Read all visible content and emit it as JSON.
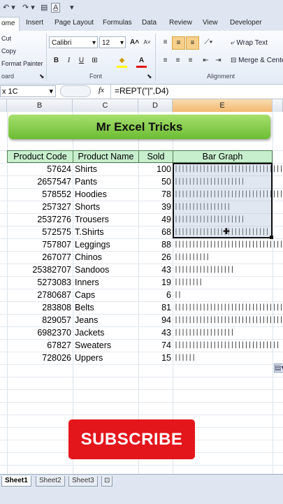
{
  "quick_access": {
    "undo_icon": "undo-icon",
    "redo_icon": "redo-icon",
    "format_icon": "format-text-icon"
  },
  "ribbon_tabs": [
    "ome",
    "Insert",
    "Page Layout",
    "Formulas",
    "Data",
    "Review",
    "View",
    "Developer"
  ],
  "clipboard": {
    "cut": "Cut",
    "copy": "Copy",
    "format_painter": "Format Painter",
    "group": "oard"
  },
  "font": {
    "name": "Calibri",
    "size": "12",
    "group": "Font",
    "bold": "B",
    "italic": "I",
    "underline": "U",
    "grow": "A",
    "shrink": "A"
  },
  "alignment": {
    "wrap_text": "Wrap Text",
    "merge": "Merge & Cente",
    "group": "Alignment"
  },
  "formula_bar": {
    "name_box": "x 1C",
    "fx": "fx",
    "formula": "=REPT(\"|\",D4)"
  },
  "columns": [
    "B",
    "C",
    "D",
    "E"
  ],
  "title_banner": "Mr Excel Tricks",
  "table": {
    "headers": [
      "Product Code",
      "Product Name",
      "Sold",
      "Bar Graph"
    ],
    "rows": [
      {
        "code": "57624",
        "name": "Shirts",
        "sold": "100",
        "value": 100
      },
      {
        "code": "2657547",
        "name": "Pants",
        "sold": "50",
        "value": 50
      },
      {
        "code": "578552",
        "name": "Hoodies",
        "sold": "78",
        "value": 78
      },
      {
        "code": "257327",
        "name": "Shorts",
        "sold": "39",
        "value": 39
      },
      {
        "code": "2537276",
        "name": "Trousers",
        "sold": "49",
        "value": 49
      },
      {
        "code": "572575",
        "name": "T.Shirts",
        "sold": "68",
        "value": 68
      },
      {
        "code": "757807",
        "name": "Leggings",
        "sold": "88",
        "value": 88
      },
      {
        "code": "267077",
        "name": "Chinos",
        "sold": "26",
        "value": 26
      },
      {
        "code": "25382707",
        "name": "Sandoos",
        "sold": "43",
        "value": 43
      },
      {
        "code": "5273083",
        "name": "Inners",
        "sold": "19",
        "value": 19
      },
      {
        "code": "2780687",
        "name": "Caps",
        "sold": "6",
        "value": 6
      },
      {
        "code": "283808",
        "name": "Belts",
        "sold": "81",
        "value": 81
      },
      {
        "code": "829057",
        "name": "Jeans",
        "sold": "94",
        "value": 94
      },
      {
        "code": "6982370",
        "name": "Jackets",
        "sold": "43",
        "value": 43
      },
      {
        "code": "67827",
        "name": "Sweaters",
        "sold": "74",
        "value": 74
      },
      {
        "code": "728026",
        "name": "Uppers",
        "sold": "15",
        "value": 15
      }
    ]
  },
  "subscribe_button": "SUBSCRIBE",
  "sheet_tabs": [
    "Sheet1",
    "Sheet2",
    "Sheet3"
  ],
  "colors": {
    "banner_green": "#7cc840",
    "header_green": "#c7efce",
    "selected_col": "#f2b86f",
    "subscribe_red": "#e3161c"
  }
}
